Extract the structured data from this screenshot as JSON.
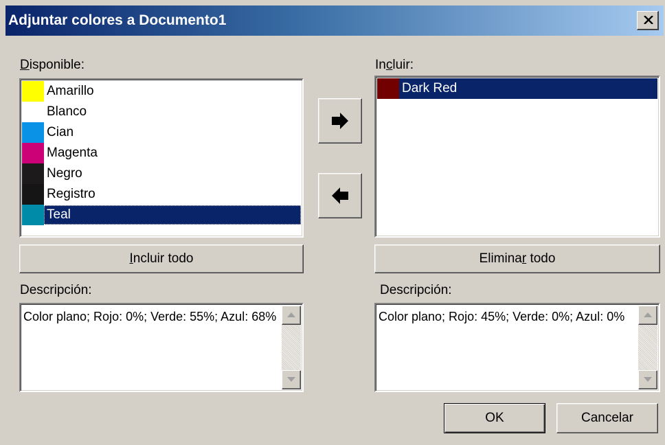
{
  "window": {
    "title": "Adjuntar colores a Documento1"
  },
  "available": {
    "label_prefix": "D",
    "label_rest": "isponible:",
    "items": [
      {
        "label": "Amarillo",
        "color": "#ffff00"
      },
      {
        "label": "Blanco",
        "color": "#ffffff"
      },
      {
        "label": "Cian",
        "color": "#0a93e6"
      },
      {
        "label": "Magenta",
        "color": "#cc0077"
      },
      {
        "label": "Negro",
        "color": "#1c1a1a"
      },
      {
        "label": "Registro",
        "color": "#151515"
      },
      {
        "label": "Teal",
        "color": "#008ca8",
        "selected": true
      }
    ],
    "include_all_mn": "I",
    "include_all_rest": "ncluir todo",
    "desc_label": "Descripción:",
    "description": "Color plano; Rojo: 0%; Verde: 55%; Azul: 68%"
  },
  "included": {
    "label_pre": "In",
    "label_mn": "c",
    "label_post": "luir:",
    "items": [
      {
        "label": "Dark Red",
        "color": "#730000",
        "selected": true
      }
    ],
    "remove_all_pre": "Elimina",
    "remove_all_mn": "r",
    "remove_all_post": " todo",
    "desc_label": "Descripción:",
    "description": "Color plano; Rojo: 45%; Verde: 0%; Azul: 0%"
  },
  "buttons": {
    "ok": "OK",
    "cancel": "Cancelar"
  },
  "icons": {
    "add": "arrow-right-icon",
    "remove": "arrow-left-icon",
    "close": "close-icon",
    "scroll_up": "scroll-up-icon",
    "scroll_down": "scroll-down-icon"
  }
}
